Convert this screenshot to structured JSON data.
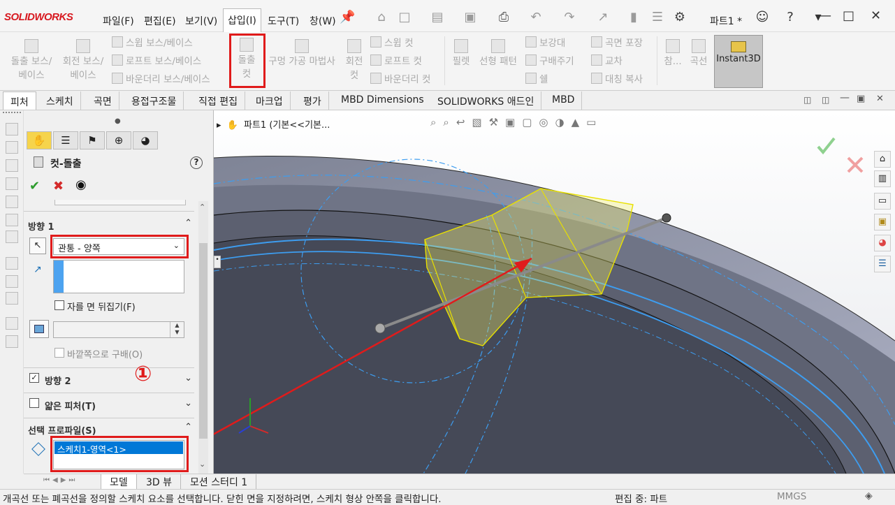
{
  "app": {
    "logo": "SOLIDWORKS",
    "doc_title": "파트1 *"
  },
  "menu": [
    "파일(F)",
    "편집(E)",
    "보기(V)",
    "삽입(I)",
    "도구(T)",
    "창(W)"
  ],
  "ribbon": {
    "extrude_boss": "돌출 보스/베이스",
    "revolve_boss": "회전 보스/베이스",
    "swept_boss": "스윕 보스/베이스",
    "lofted_boss": "로프트 보스/베이스",
    "boundary_boss": "바운더리 보스/베이스",
    "extrude_cut_line1": "돌출",
    "extrude_cut_line2": "컷",
    "hole_wizard": "구멍 가공 마법사",
    "revolve_cut": "회전 컷",
    "swept_cut": "스윕 컷",
    "lofted_cut": "로프트 컷",
    "boundary_cut": "바운더리 컷",
    "fillet": "필렛",
    "linear_pattern": "선형 패턴",
    "rib": "보강대",
    "draft": "구배주기",
    "shell": "쉘",
    "wrap": "곡면 포장",
    "intersect": "교차",
    "mirror": "대칭 복사",
    "reference": "참...",
    "curves": "곡선",
    "instant3d": "Instant3D"
  },
  "tabs": [
    "피처",
    "스케치",
    "곡면",
    "용접구조물",
    "직접 편집",
    "마크업",
    "평가",
    "MBD Dimensions",
    "SOLIDWORKS 애드인",
    "MBD"
  ],
  "tree_path": "파트1  (기본<<기본...",
  "pm": {
    "title": "컷-돌출",
    "direction1": "방향 1",
    "end_condition": "관통 - 양쪽",
    "flip_side": "자를 면 뒤집기(F)",
    "draft_outward": "바깥쪽으로 구배(O)",
    "direction2": "방향 2",
    "thin_feature": "얇은 피처(T)",
    "selected_contours": "선택 프로파일(S)",
    "contour_item": "스케치1-영역<1>",
    "help": "?"
  },
  "annotation": {
    "marker": "①"
  },
  "bottom_tabs": [
    "모델",
    "3D 뷰",
    "모션 스터디 1"
  ],
  "status": {
    "message": "개곡선 또는 폐곡선을 정의할 스케치 요소를 선택합니다. 닫힌 면을 지정하려면, 스케치 형상 안쪽을 클릭합니다.",
    "mode": "편집 중: 파트",
    "units": "MMGS"
  },
  "colors": {
    "accent_red": "#e01b1b",
    "selection_blue": "#0078d7",
    "sketch_blue": "#3d9df0",
    "preview_yellow": "#f4f06a"
  },
  "icons": [
    "home-icon",
    "part-icon",
    "folder-icon",
    "appearance-icon",
    "palette-icon",
    "list-icon"
  ]
}
